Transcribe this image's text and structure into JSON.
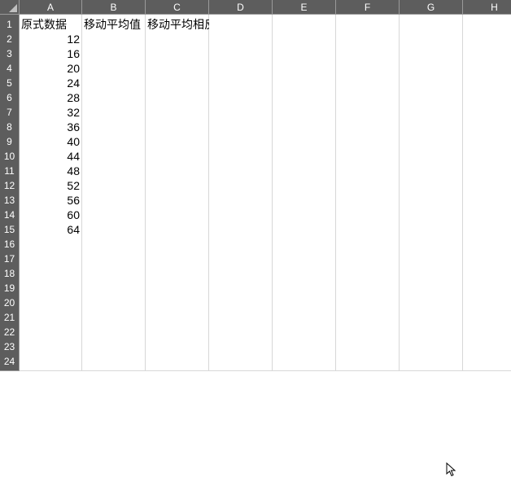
{
  "columns": [
    "A",
    "B",
    "C",
    "D",
    "E",
    "F",
    "G",
    "H"
  ],
  "rowCount": 24,
  "cells": {
    "r1": {
      "A": "原式数据",
      "B": "移动平均值",
      "C": "移动平均相反数"
    },
    "r2": {
      "A": "12"
    },
    "r3": {
      "A": "16"
    },
    "r4": {
      "A": "20"
    },
    "r5": {
      "A": "24"
    },
    "r6": {
      "A": "28"
    },
    "r7": {
      "A": "32"
    },
    "r8": {
      "A": "36"
    },
    "r9": {
      "A": "40"
    },
    "r10": {
      "A": "44"
    },
    "r11": {
      "A": "48"
    },
    "r12": {
      "A": "52"
    },
    "r13": {
      "A": "56"
    },
    "r14": {
      "A": "60"
    },
    "r15": {
      "A": "64"
    }
  }
}
